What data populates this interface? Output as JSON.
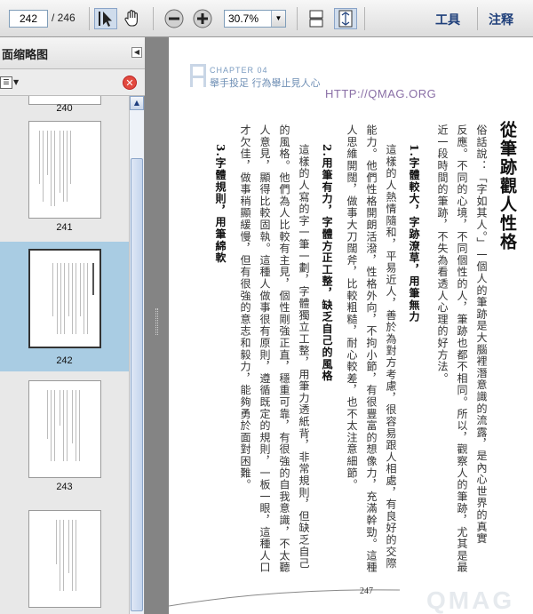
{
  "toolbar": {
    "current_page": "242",
    "page_total": "/ 246",
    "zoom": "30.7%",
    "tools_label": "工具",
    "comment_label": "注释"
  },
  "sidebar": {
    "title": "面缩略图",
    "thumbnails": [
      {
        "label": "240"
      },
      {
        "label": "241"
      },
      {
        "label": "242",
        "selected": true
      },
      {
        "label": "243"
      },
      {
        "label": ""
      }
    ]
  },
  "page": {
    "chapter": "CHAPTER 04",
    "chapter_sub": "舉手投足 行為舉止見人心",
    "url": "HTTP://QMAG.ORG",
    "title": "從筆跡觀人性格",
    "columns": [
      {
        "text": "俗話說：「字如其人。」一個人的筆跡是大腦裡潛意識的流露，是內心世界的真實",
        "head": false
      },
      {
        "text": "反應。不同的心境，不同個性的人，筆跡也都不相同。所以，觀察人的筆跡，尤其是最",
        "head": false
      },
      {
        "text": "近一段時間的筆跡，不失為看透人心理的好方法。",
        "head": false
      },
      {
        "text": "1.字體較大，字跡潦草，用筆無力",
        "head": true
      },
      {
        "text": "這樣的人熱情隨和，平易近人，善於為對方考慮，很容易跟人相處，有良好的交際",
        "head": false
      },
      {
        "text": "能力。他們性格開朗活潑，性格外向，不拘小節，有很豐富的想像力，充滿幹勁。這種",
        "head": false
      },
      {
        "text": "人思維開闊，做事大刀闊斧，比較粗糙，耐心較差，也不太注意細節。",
        "head": false
      },
      {
        "text": "2.用筆有力，字體方正工整，缺乏自己的風格",
        "head": true
      },
      {
        "text": "這樣的人寫的字一筆一劃，字體獨立工整，用筆力透紙背，非常規則，但缺乏自己",
        "head": false
      },
      {
        "text": "的風格。他們為人比較有主見，個性剛強正直，穩重可靠，有很強的自我意識，不太聽",
        "head": false
      },
      {
        "text": "人意見，顯得比較固執。這種人做事很有原則，遵循既定的規則，一板一眼，這種人口",
        "head": false
      },
      {
        "text": "才欠佳，做事稍顯緩慢，但有很強的意志和毅力，能夠勇於面對困難。",
        "head": false
      },
      {
        "text": "3.字體規則，用筆綿軟",
        "head": true
      }
    ],
    "page_number": "247",
    "watermark": "QMAG"
  }
}
